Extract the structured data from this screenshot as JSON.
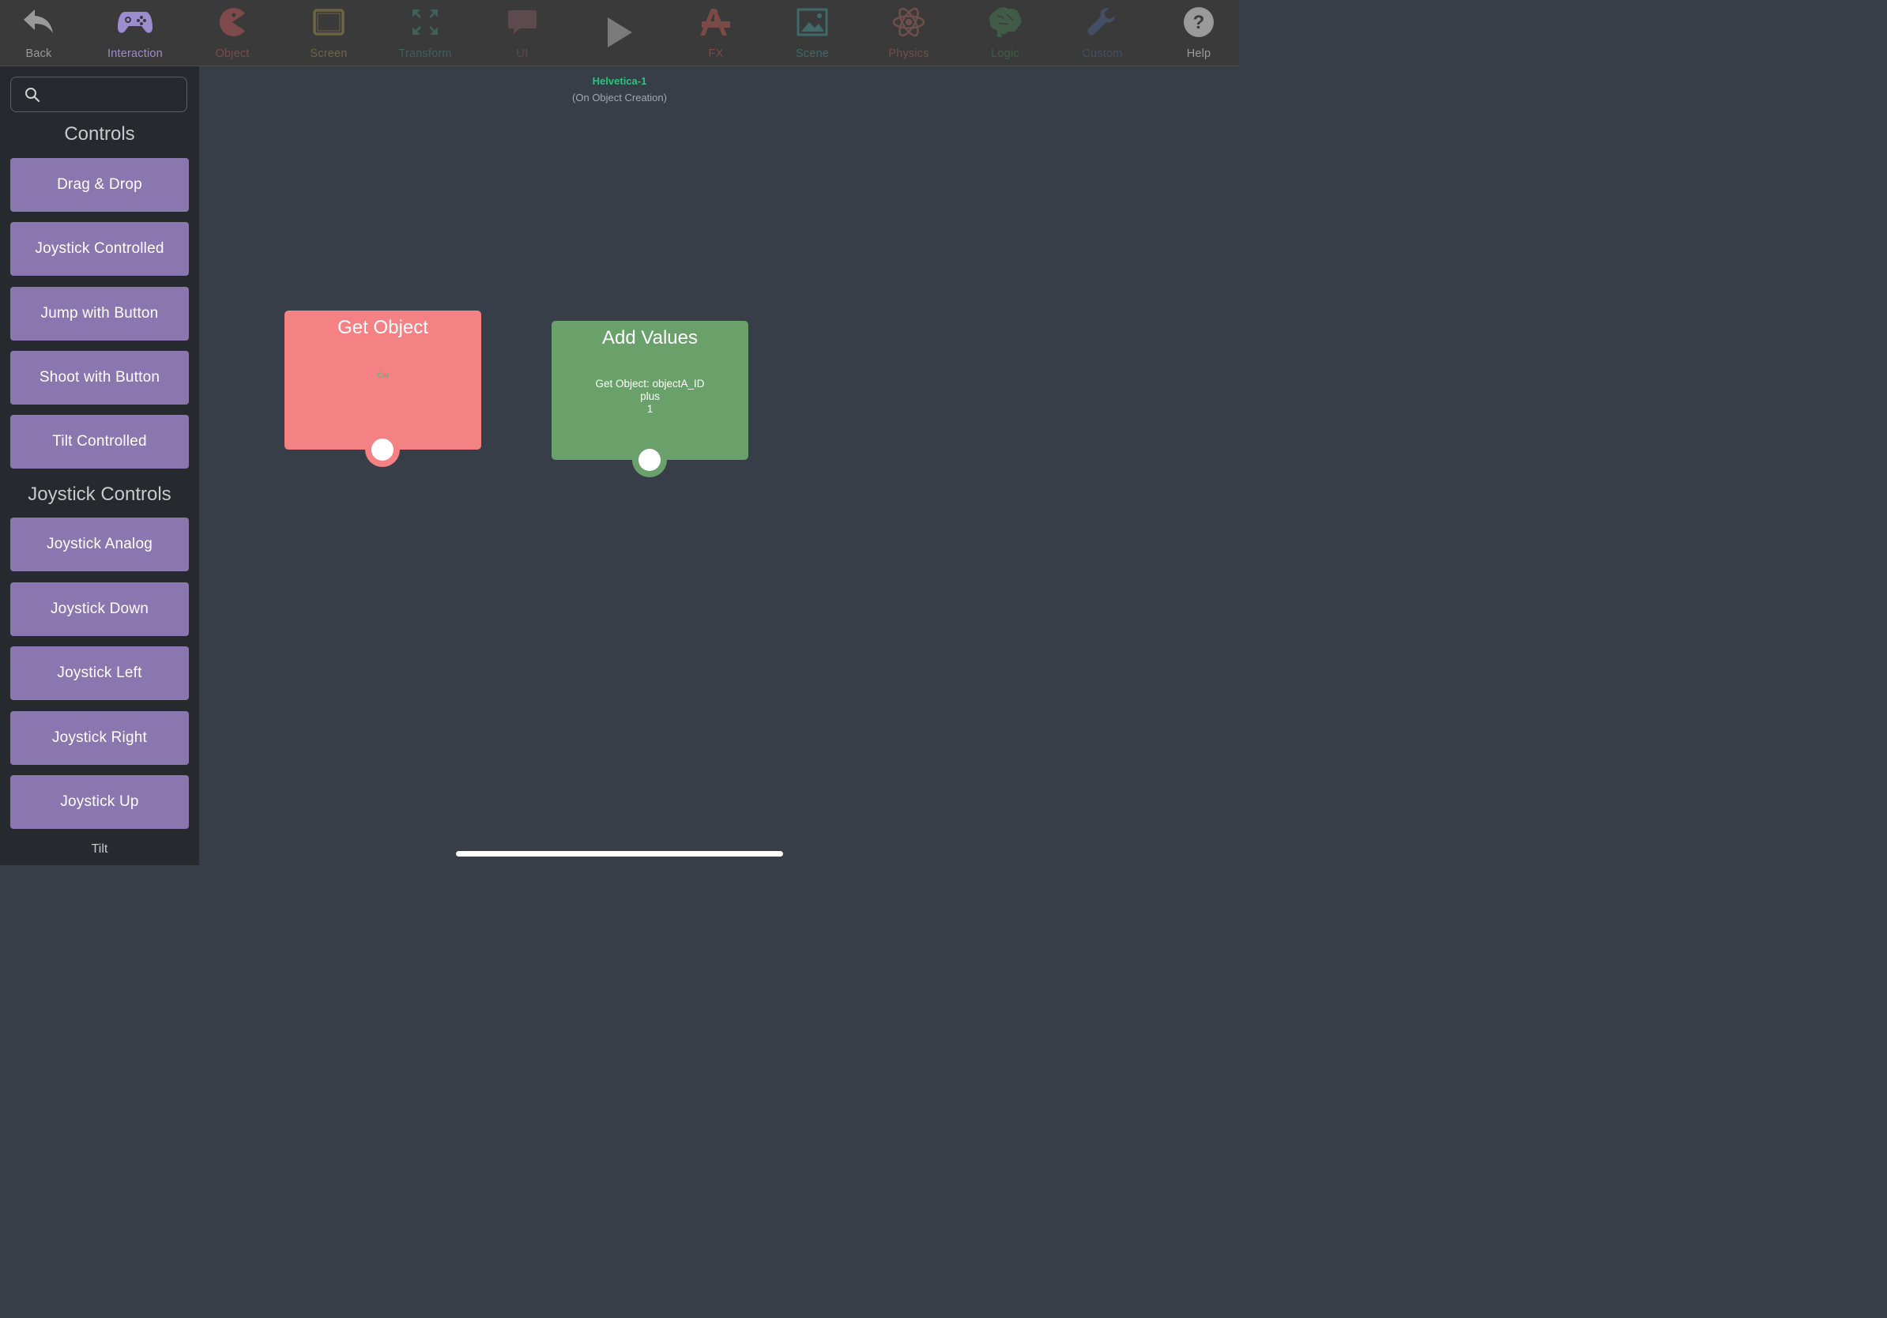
{
  "toolbar": {
    "items": [
      {
        "label": "Back",
        "icon": "back-arrow-icon",
        "color": "#9a9a9a"
      },
      {
        "label": "Interaction",
        "icon": "gamepad-icon",
        "color": "#9c8cd0",
        "active": true
      },
      {
        "label": "Object",
        "icon": "pacman-icon",
        "color": "#7e4a4c"
      },
      {
        "label": "Screen",
        "icon": "tablet-icon",
        "color": "#6e6446"
      },
      {
        "label": "Transform",
        "icon": "expand-arrows-icon",
        "color": "#3f5f5a"
      },
      {
        "label": "UI",
        "icon": "speech-bubble-icon",
        "color": "#5c4a4d"
      },
      {
        "label": "",
        "icon": "play-icon",
        "color": "#7a7a7a"
      },
      {
        "label": "FX",
        "icon": "brush-ruler-icon",
        "color": "#7a4a46"
      },
      {
        "label": "Scene",
        "icon": "picture-icon",
        "color": "#3e6a6a"
      },
      {
        "label": "Physics",
        "icon": "atom-icon",
        "color": "#6e4f4c"
      },
      {
        "label": "Logic",
        "icon": "brain-icon",
        "color": "#405c48"
      },
      {
        "label": "Custom",
        "icon": "wrench-icon",
        "color": "#444f66"
      },
      {
        "label": "Help",
        "icon": "help-icon",
        "color": "#9a9a9a"
      }
    ]
  },
  "sidebar": {
    "search": {
      "value": "",
      "placeholder": ""
    },
    "sections": [
      {
        "title": "Controls",
        "items": [
          "Drag & Drop",
          "Joystick Controlled",
          "Jump with Button",
          "Shoot with Button",
          "Tilt Controlled"
        ]
      },
      {
        "title": "Joystick Controls",
        "items": [
          "Joystick Analog",
          "Joystick Down",
          "Joystick Left",
          "Joystick Right",
          "Joystick Up"
        ]
      }
    ],
    "next_section": "Tilt"
  },
  "canvas": {
    "title": "Helvetica-1",
    "subtitle": "(On Object Creation)",
    "nodes": {
      "get_object": {
        "title": "Get Object",
        "text": "Cat",
        "color": "#f48285"
      },
      "add_values": {
        "title": "Add Values",
        "lines": [
          "Get Object: objectA_ID",
          "plus",
          "1"
        ],
        "color": "#6aa16b"
      }
    }
  }
}
